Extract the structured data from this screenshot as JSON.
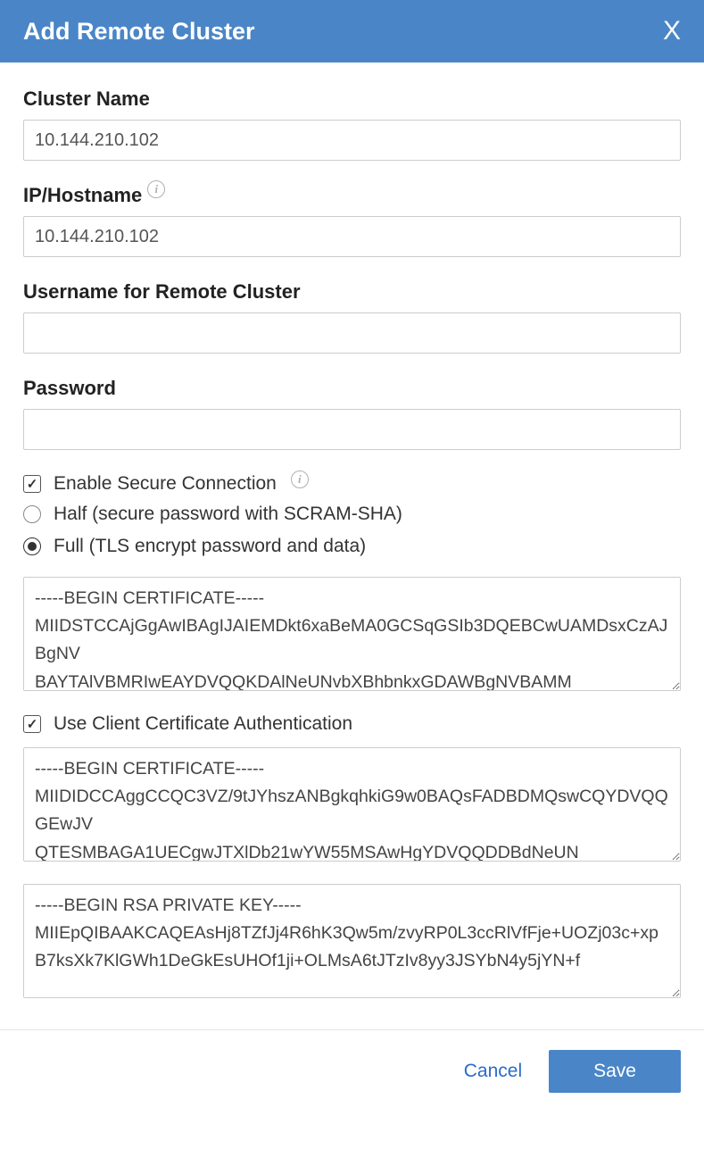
{
  "header": {
    "title": "Add Remote Cluster",
    "close": "X"
  },
  "fields": {
    "clusterName": {
      "label": "Cluster Name",
      "value": "10.144.210.102"
    },
    "ipHostname": {
      "label": "IP/Hostname",
      "value": "10.144.210.102"
    },
    "username": {
      "label": "Username for Remote Cluster",
      "value": ""
    },
    "password": {
      "label": "Password",
      "value": ""
    }
  },
  "secure": {
    "enableLabel": "Enable Secure Connection",
    "enabled": true,
    "options": {
      "half": "Half (secure password with SCRAM-SHA)",
      "full": "Full (TLS encrypt password and data)"
    },
    "selected": "full",
    "certificate": "-----BEGIN CERTIFICATE-----\nMIIDSTCCAjGgAwIBAgIJAIEMDkt6xaBeMA0GCSqGSIb3DQEBCwUAMDsxCzAJBgNV\nBAYTAlVBMRIwEAYDVQQKDAlNeUNvbXBhbnkxGDAWBgNVBAMM",
    "clientCertAuth": {
      "label": "Use Client Certificate Authentication",
      "enabled": true,
      "clientCert": "-----BEGIN CERTIFICATE-----\nMIIDIDCCAggCCQC3VZ/9tJYhszANBgkqhkiG9w0BAQsFADBDMQswCQYDVQQGEwJV\nQTESMBAGA1UECgwJTXlDb21wYW55MSAwHgYDVQQDDBdNeUN",
      "privateKey": "-----BEGIN RSA PRIVATE KEY-----\nMIIEpQIBAAKCAQEAsHj8TZfJj4R6hK3Qw5m/zvyRP0L3ccRlVfFje+UOZj03c+xp\nB7ksXk7KlGWh1DeGkEsUHOf1ji+OLMsA6tJTzIv8yy3JSYbN4y5jYN+f"
    }
  },
  "footer": {
    "cancel": "Cancel",
    "save": "Save"
  }
}
